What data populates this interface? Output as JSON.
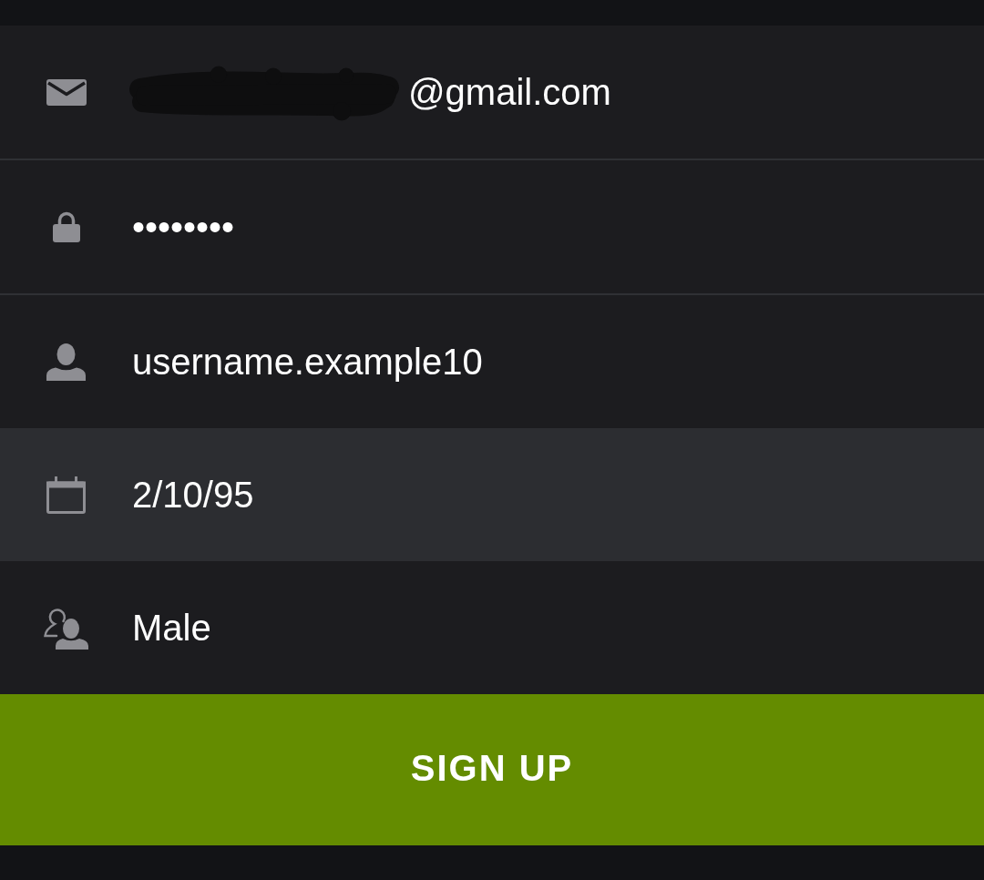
{
  "fields": [
    {
      "kind": "email",
      "value": "@gmail.com",
      "redacted": true,
      "focused": false
    },
    {
      "kind": "password",
      "value": "••••••••",
      "redacted": false,
      "focused": false
    },
    {
      "kind": "username",
      "value": "username.example10",
      "redacted": false,
      "focused": false
    },
    {
      "kind": "birthdate",
      "value": "2/10/95",
      "redacted": false,
      "focused": true
    },
    {
      "kind": "gender",
      "value": "Male",
      "redacted": false,
      "focused": false
    }
  ],
  "button": {
    "label": "SIGN UP"
  }
}
